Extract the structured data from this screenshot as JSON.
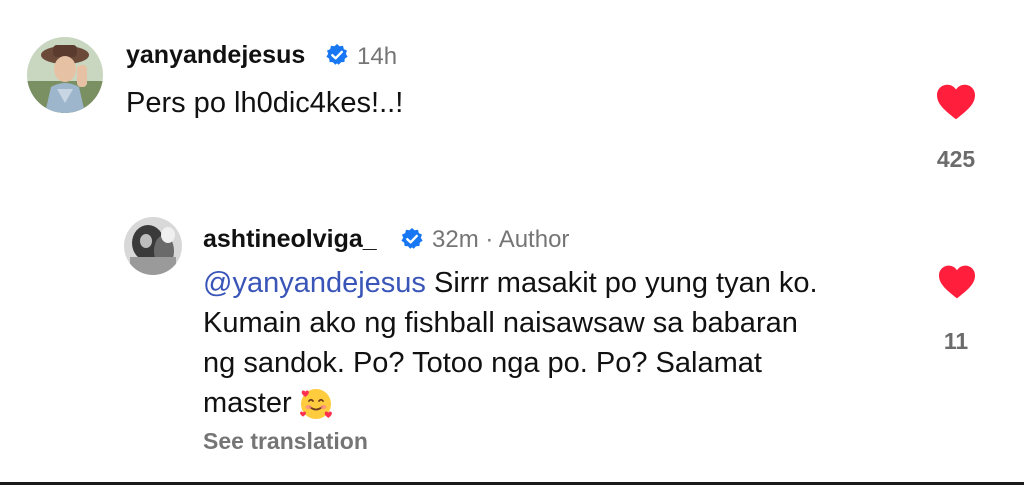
{
  "comments": [
    {
      "username": "yanyandejesus",
      "verified": true,
      "time": "14h",
      "text": "Pers po lh0dic4kes!..!",
      "likes": "425",
      "liked": true
    }
  ],
  "reply": {
    "username": "ashtineolviga_",
    "verified": true,
    "time": "32m",
    "separator": "·",
    "author_badge": "Author",
    "mention": "@yanyandejesus",
    "text_line1": " Sirrr masakit po yung tyan ko.",
    "text_line2": "Kumain ako ng fishball naisawsaw sa babaran",
    "text_line3": "ng sandok. Po? Totoo nga po. Po? Salamat",
    "text_line4": "master",
    "emoji": "smiling-face-with-hearts",
    "likes": "11",
    "liked": true,
    "see_translation": "See translation"
  },
  "colors": {
    "heart": "#ff1f3d",
    "verified": "#1877f2",
    "mention": "#3a55b8",
    "muted": "#757575"
  }
}
